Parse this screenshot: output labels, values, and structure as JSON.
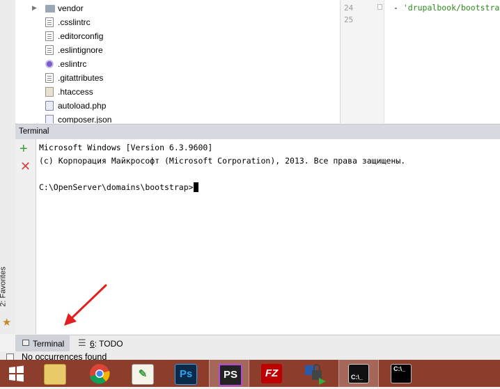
{
  "sidebar": {
    "favorites_label": "2: Favorites"
  },
  "tree": {
    "items": [
      {
        "name": "vendor"
      },
      {
        "name": ".csslintrc"
      },
      {
        "name": ".editorconfig"
      },
      {
        "name": ".eslintignore"
      },
      {
        "name": ".eslintrc"
      },
      {
        "name": ".gitattributes"
      },
      {
        "name": ".htaccess"
      },
      {
        "name": "autoload.php"
      },
      {
        "name": "composer.json"
      }
    ]
  },
  "editor": {
    "lines": [
      {
        "number": "24",
        "dash": "- ",
        "text": "'drupalbook/bootstra"
      },
      {
        "number": "25"
      }
    ]
  },
  "terminal": {
    "title": "Terminal",
    "lines": [
      "Microsoft Windows [Version 6.3.9600]",
      "(c) Корпорация Майкрософт (Microsoft Corporation), 2013. Все права защищены.",
      "C:\\OpenServer\\domains\\bootstrap>"
    ]
  },
  "toolwindows": {
    "terminal_label": "Terminal",
    "todo_num": "6",
    "todo_label": ": TODO"
  },
  "status": {
    "text": "No occurrences found"
  },
  "taskbar": {
    "apps": [
      {
        "icon": "windows-start-icon"
      },
      {
        "icon": "file-explorer-icon"
      },
      {
        "icon": "chrome-icon"
      },
      {
        "icon": "notepad-plus-icon"
      },
      {
        "icon": "photoshop-icon",
        "text": "Ps"
      },
      {
        "icon": "phpstorm-icon",
        "text": "PS"
      },
      {
        "icon": "filezilla-icon",
        "text": "FZ"
      },
      {
        "icon": "network-lock-icon"
      },
      {
        "icon": "console-icon",
        "text": "C:\\_"
      },
      {
        "icon": "cmd-icon",
        "text": "C:\\_"
      }
    ]
  },
  "colors": {
    "taskbar": "#8c3d2c",
    "annotation_arrow": "#e02020",
    "string": "#2b8a1a"
  }
}
